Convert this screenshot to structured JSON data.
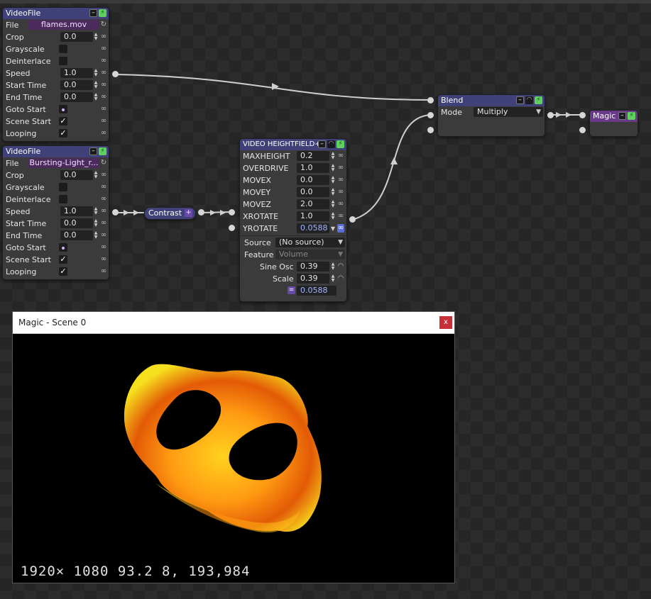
{
  "videofile1": {
    "title": "VideoFile",
    "file_label": "File",
    "file_value": "flames.mov",
    "rows": [
      {
        "label": "Crop",
        "value": "0.0"
      },
      {
        "label": "Grayscale"
      },
      {
        "label": "Deinterlace"
      },
      {
        "label": "Speed",
        "value": "1.0"
      },
      {
        "label": "Start Time",
        "value": "0.0"
      },
      {
        "label": "End Time",
        "value": "0.0"
      },
      {
        "label": "Goto Start"
      },
      {
        "label": "Scene Start",
        "check": "✓"
      },
      {
        "label": "Looping",
        "check": "✓"
      }
    ]
  },
  "videofile2": {
    "title": "VideoFile",
    "file_label": "File",
    "file_value": "Bursting-Light_r...",
    "rows": [
      {
        "label": "Crop",
        "value": "0.0"
      },
      {
        "label": "Grayscale"
      },
      {
        "label": "Deinterlace"
      },
      {
        "label": "Speed",
        "value": "1.0"
      },
      {
        "label": "Start Time",
        "value": "0.0"
      },
      {
        "label": "End Time",
        "value": "0.0"
      },
      {
        "label": "Goto Start"
      },
      {
        "label": "Scene Start",
        "check": "✓"
      },
      {
        "label": "Looping",
        "check": "✓"
      }
    ]
  },
  "contrast": {
    "title": "Contrast"
  },
  "blend": {
    "title": "Blend",
    "mode_label": "Mode",
    "mode_value": "Multiply"
  },
  "magic": {
    "title": "Magic"
  },
  "heightfield": {
    "title": "VIDEO HEIGHTFIELD+",
    "rows": [
      {
        "label": "MAXHEIGHT",
        "value": "0.2"
      },
      {
        "label": "OVERDRIVE",
        "value": "1.0"
      },
      {
        "label": "MOVEX",
        "value": "0.0"
      },
      {
        "label": "MOVEY",
        "value": "0.0"
      },
      {
        "label": "MOVEZ",
        "value": "2.0"
      },
      {
        "label": "XROTATE",
        "value": "1.0"
      },
      {
        "label": "YROTATE",
        "value": "0.0588"
      }
    ],
    "source_label": "Source",
    "source_value": "(No source)",
    "feature_label": "Feature",
    "feature_value": "Volume",
    "sine_label": "Sine Osc",
    "sine_value": "0.39",
    "scale_label": "Scale",
    "scale_value": "0.39",
    "output_value": "0.0588"
  },
  "preview": {
    "title": "Magic - Scene 0",
    "close": "x",
    "stats": "1920× 1080  93.2  8, 193,984"
  },
  "colors": {
    "node_title": "#41417a",
    "file_field": "#4c2a5c",
    "magic_title": "#6a3a8a",
    "run_button": "#5fd15f",
    "close_button": "#c8303a"
  }
}
